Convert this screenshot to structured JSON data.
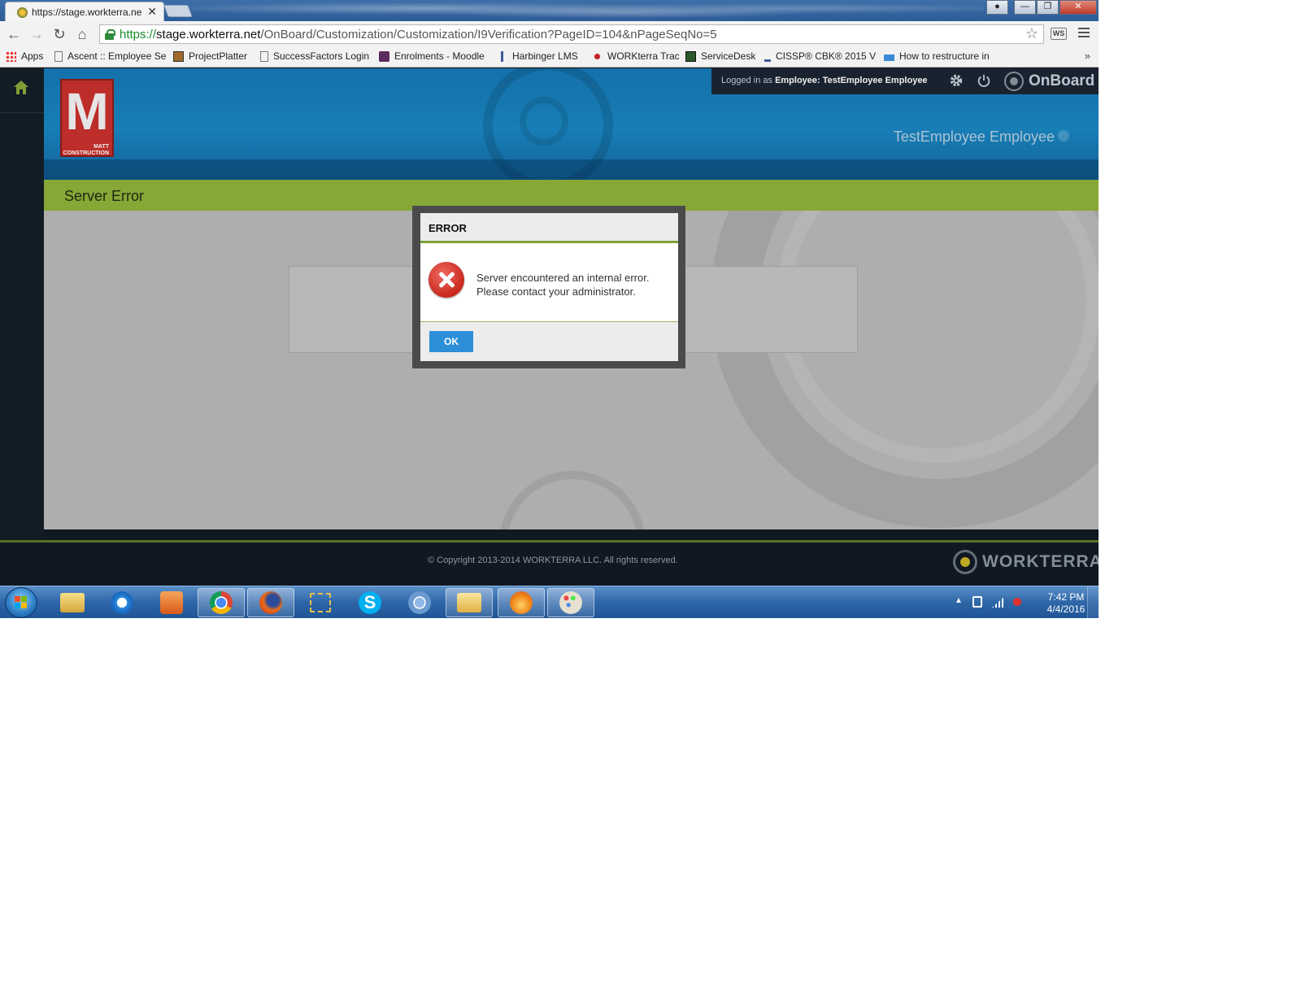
{
  "browser": {
    "tab_title": "https://stage.workterra.ne",
    "tab_close": "✕",
    "url_proto": "https://",
    "url_host": "stage.workterra.net",
    "url_path": "/OnBoard/Customization/Customization/I9Verification?PageID=104&nPageSeqNo=5",
    "ext_label": "WS",
    "overflow": "»",
    "bookmarks": [
      {
        "label": "Apps",
        "icon": "apps-grid-icon"
      },
      {
        "label": "Ascent :: Employee Se",
        "icon": "page-icon"
      },
      {
        "label": "ProjectPlatter",
        "icon": "projectplatter-icon"
      },
      {
        "label": "SuccessFactors Login",
        "icon": "page-icon"
      },
      {
        "label": "Enrolments - Moodle",
        "icon": "moodle-icon"
      },
      {
        "label": "Harbinger LMS",
        "icon": "harbinger-icon"
      },
      {
        "label": "WORKterra Trac",
        "icon": "trac-icon"
      },
      {
        "label": "ServiceDesk",
        "icon": "servicedesk-icon"
      },
      {
        "label": "CISSP® CBK® 2015 V",
        "icon": "cissp-icon"
      },
      {
        "label": "How to restructure in",
        "icon": "sap-icon"
      }
    ]
  },
  "app": {
    "logo_letter": "M",
    "logo_sub1": "MATT",
    "logo_sub2": "CONSTRUCTION",
    "logged_in_prefix": "Logged in as",
    "logged_in_role": "Employee:",
    "logged_in_user": "TestEmployee Employee",
    "product_name": "OnBoard",
    "header_username": "TestEmployee Employee",
    "page_title": "Server Error",
    "footer_copyright": "© Copyright 2013-2014 WORKTERRA LLC. All rights reserved.",
    "footer_brand": "WORKTERRA"
  },
  "dialog": {
    "title": "ERROR",
    "message_line1": "Server encountered an internal error.",
    "message_line2": "Please contact your administrator.",
    "ok_label": "OK"
  },
  "taskbar": {
    "apps": [
      "file-explorer-icon",
      "internet-explorer-icon",
      "media-player-icon",
      "chrome-icon",
      "firefox-icon",
      "snipping-tool-icon",
      "skype-icon",
      "chromium-icon",
      "outlook-icon",
      "app-flame-icon",
      "paint-icon"
    ],
    "time": "7:42 PM",
    "date": "4/4/2016"
  },
  "colors": {
    "header_blue": "#1a86c2",
    "title_green": "#8fb33a",
    "ok_blue": "#2d8fd8",
    "error_red": "#c8281e"
  }
}
